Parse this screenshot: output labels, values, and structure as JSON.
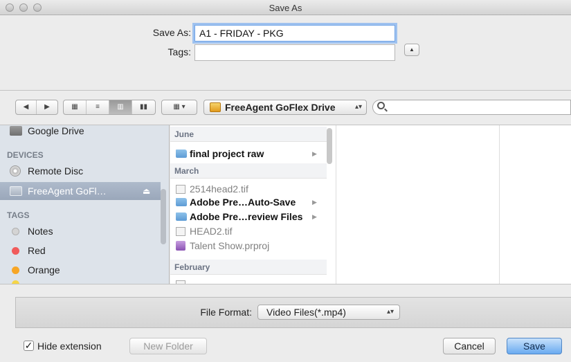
{
  "window": {
    "title": "Save As"
  },
  "form": {
    "save_as_label": "Save As:",
    "save_as_value": "A1 - FRIDAY - PKG",
    "tags_label": "Tags:",
    "tags_value": ""
  },
  "toolbar": {
    "back": "◀",
    "forward": "▶",
    "view_modes": [
      "icon-view",
      "list-view",
      "column-view",
      "coverflow-view"
    ],
    "active_view": "column-view",
    "arrange": "▦ ▾",
    "location": "FreeAgent GoFlex Drive",
    "search_value": ""
  },
  "sidebar": {
    "partial_item": "Google Drive",
    "devices_header": "DEVICES",
    "devices": [
      {
        "label": "Remote Disc",
        "icon": "disc-icon"
      },
      {
        "label": "FreeAgent GoFl…",
        "icon": "external-drive-icon",
        "selected": true,
        "eject": "⏏"
      }
    ],
    "tags_header": "TAGS",
    "tags": [
      {
        "label": "Notes",
        "color": "#c9c9c9"
      },
      {
        "label": "Red",
        "color": "#f15b5b"
      },
      {
        "label": "Orange",
        "color": "#f7a626"
      }
    ]
  },
  "browser": {
    "groups": [
      {
        "label": "June"
      },
      {
        "label": "March"
      },
      {
        "label": "February"
      }
    ],
    "june_items": [
      {
        "name": "final project raw",
        "type": "folder",
        "has_children": true
      }
    ],
    "march_items": [
      {
        "name": "2514head2.tif",
        "type": "doc",
        "dim": true
      },
      {
        "name": "Adobe Pre…Auto-Save",
        "type": "folder",
        "has_children": true
      },
      {
        "name": "Adobe Pre…review Files",
        "type": "folder",
        "has_children": true
      },
      {
        "name": "HEAD2.tif",
        "type": "doc",
        "dim": true
      },
      {
        "name": "Talent Show.prproj",
        "type": "premiere",
        "dim": true
      }
    ]
  },
  "bottom": {
    "file_format_label": "File Format:",
    "file_format_value": "Video Files(*.mp4)",
    "hide_extension_label": "Hide extension",
    "hide_extension_checked": true,
    "new_folder": "New Folder",
    "cancel": "Cancel",
    "save": "Save"
  }
}
